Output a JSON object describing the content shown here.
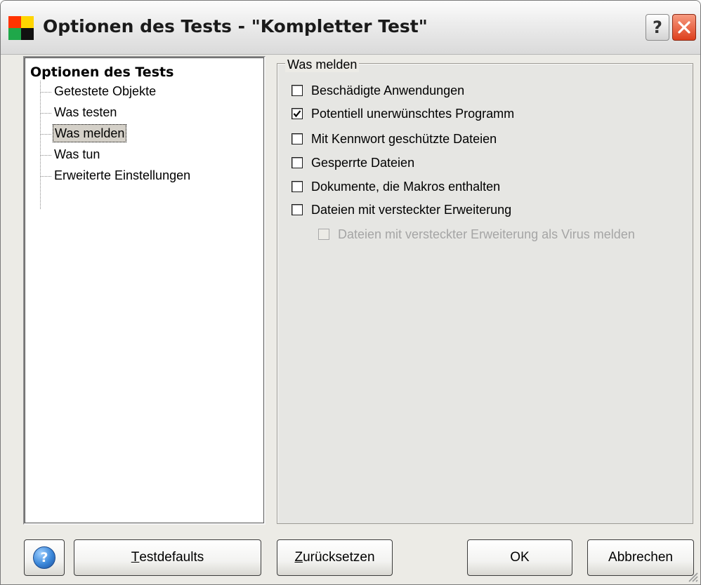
{
  "window": {
    "title": "Optionen des Tests - \"Kompletter Test\"",
    "help_glyph": "?",
    "icons": {
      "app": "four-color-squares-icon",
      "help": "question-mark-icon",
      "close": "close-x-icon"
    }
  },
  "tree": {
    "root": "Optionen des Tests",
    "items": [
      {
        "label": "Getestete Objekte",
        "selected": false
      },
      {
        "label": "Was testen",
        "selected": false
      },
      {
        "label": "Was melden",
        "selected": true
      },
      {
        "label": "Was tun",
        "selected": false
      },
      {
        "label": "Erweiterte Einstellungen",
        "selected": false
      }
    ]
  },
  "group": {
    "legend": "Was melden",
    "options": [
      {
        "label": "Beschädigte Anwendungen",
        "checked": false,
        "enabled": true
      },
      {
        "label": "Potentiell unerwünschtes Programm",
        "checked": true,
        "enabled": true
      },
      {
        "label": "Mit Kennwort geschützte Dateien",
        "checked": false,
        "enabled": true
      },
      {
        "label": "Gesperrte Dateien",
        "checked": false,
        "enabled": true
      },
      {
        "label": "Dokumente, die Makros enthalten",
        "checked": false,
        "enabled": true
      },
      {
        "label": "Dateien mit versteckter Erweiterung",
        "checked": false,
        "enabled": true
      },
      {
        "label": "Dateien mit versteckter Erweiterung als Virus melden",
        "checked": false,
        "enabled": false
      }
    ]
  },
  "buttons": {
    "help_glyph": "?",
    "testdefaults": {
      "accel": "T",
      "rest": "estdefaults"
    },
    "reset": {
      "accel": "Z",
      "rest": "urücksetzen"
    },
    "ok": "OK",
    "cancel": "Abbrechen"
  },
  "colors": {
    "dialog_bg": "#ecebe6",
    "group_bg": "#e6e6e3",
    "disabled_text": "#a5a5a5",
    "selection_bg": "#d4d0c8",
    "close_red": "#dd3f1c",
    "help_blue": "#3a86d8"
  }
}
